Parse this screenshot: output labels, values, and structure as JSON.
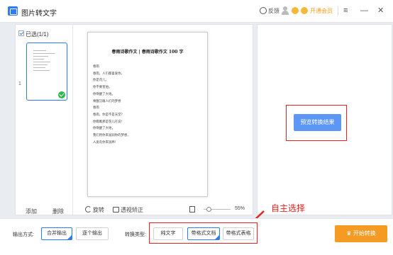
{
  "titlebar": {
    "app_title": "图片转文字",
    "feedback": "反馈",
    "vip": "开通会员",
    "minimize": "—",
    "menu": "≡",
    "close": "✕",
    "accent": "#2d7cf6",
    "vip_color": "#f29d1a"
  },
  "thumbs": {
    "selected_label": "已选(1/1)",
    "page_number": "1",
    "add": "添加",
    "delete": "删除"
  },
  "document": {
    "title": "春雨诗歌作文 | 春雨诗歌作文 100 字",
    "lines": [
      "春雨",
      "春雨，人们都喜爱你。",
      "你是花儿，",
      "你不要害怕，",
      "你唤醒了大地。",
      "唤醒沉睡人们的梦想",
      "春雨",
      "春雨，你是不是天堂？",
      "你瞧瞧那是花儿在说！",
      "你唤醒了大地，",
      "我们用你来滋润你的梦想，",
      "人类有你来润养！"
    ]
  },
  "toolbar": {
    "rotate": "旋转",
    "perspective": "透视矫正",
    "zoom": "55%"
  },
  "right": {
    "preview_button": "预览转换结果"
  },
  "bottom": {
    "output_label": "输出方式:",
    "merge": "合并输出",
    "single": "逐个输出",
    "type_label": "转换类型:",
    "plain": "纯文字",
    "formatted_doc": "带格式文档",
    "formatted_table": "带格式表格",
    "start": "开始转换",
    "start_color": "#f59a23"
  },
  "annotation": {
    "text": "自主选择",
    "color": "#e8211d"
  }
}
